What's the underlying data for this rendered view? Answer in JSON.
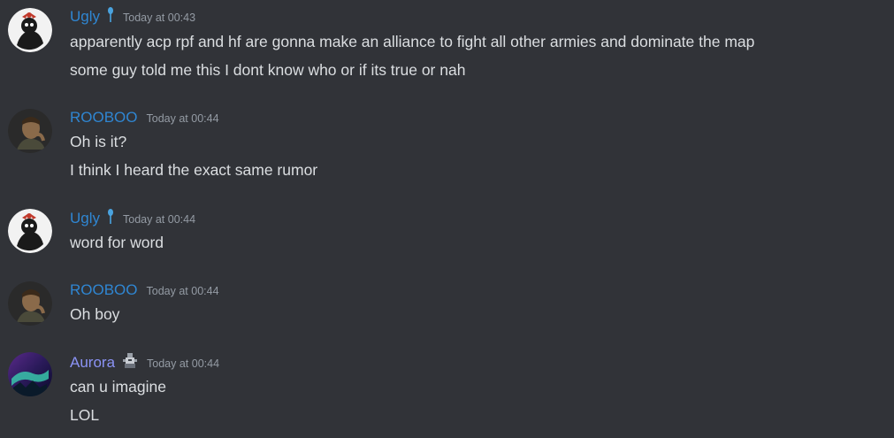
{
  "messages": [
    {
      "user": "Ugly",
      "badge": "blue-pin-icon",
      "time": "Today at 00:43",
      "lines": [
        "apparently acp rpf and hf are gonna make an alliance to fight all other armies and dominate the map",
        "some guy told me this I dont know who or if its true or nah"
      ]
    },
    {
      "user": "ROOBOO",
      "time": "Today at 00:44",
      "lines": [
        "Oh is it?",
        "I think I heard the exact same rumor"
      ]
    },
    {
      "user": "Ugly",
      "badge": "blue-pin-icon",
      "time": "Today at 00:44",
      "lines": [
        "word for word"
      ]
    },
    {
      "user": "ROOBOO",
      "time": "Today at 00:44",
      "lines": [
        "Oh boy"
      ]
    },
    {
      "user": "Aurora",
      "badge": "robot-figure-icon",
      "time": "Today at 00:44",
      "lines": [
        "can u imagine",
        "LOL"
      ]
    }
  ],
  "colors": {
    "background": "#313338",
    "username_blue": "#2f86d2",
    "username_aurora": "#8b93f5",
    "timestamp": "#949ba4",
    "text": "#dbdee1"
  }
}
